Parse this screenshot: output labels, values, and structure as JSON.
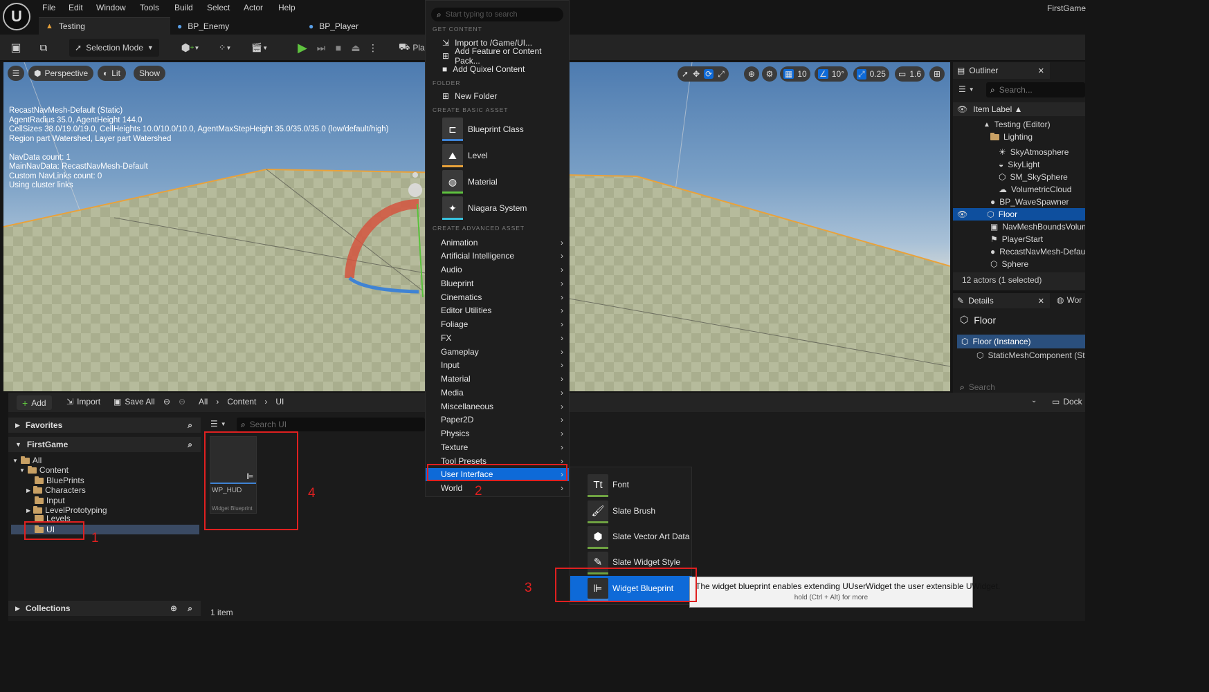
{
  "app": {
    "title": "FirstGame",
    "menu": [
      "File",
      "Edit",
      "Window",
      "Tools",
      "Build",
      "Select",
      "Actor",
      "Help"
    ],
    "tabs": [
      {
        "label": "Testing"
      },
      {
        "label": "BP_Enemy"
      },
      {
        "label": "BP_Player"
      }
    ]
  },
  "toolbar": {
    "selection_mode": "Selection Mode",
    "play_label": "Pla"
  },
  "viewport": {
    "perspective": "Perspective",
    "lit": "Lit",
    "show": "Show",
    "grid_snap": "10",
    "rot_snap": "10°",
    "scale_snap": "0.25",
    "cam_speed": "1.6",
    "nav_info": "RecastNavMesh-Default (Static)\nAgentRadius 35.0, AgentHeight 144.0\nCellSizes 38.0/19.0/19.0, CellHeights 10.0/10.0/10.0, AgentMaxStepHeight 35.0/35.0/35.0 (low/default/high)\nRegion part Watershed, Layer part Watershed\n\nNavData count: 1\nMainNavData: RecastNavMesh-Default\nCustom NavLinks count: 0\nUsing cluster links"
  },
  "outliner": {
    "title": "Outliner",
    "search_placeholder": "Search...",
    "column": "Item Label ▲",
    "items": [
      "Testing (Editor)",
      "Lighting",
      "SkyAtmosphere",
      "SkyLight",
      "SM_SkySphere",
      "VolumetricCloud",
      "BP_WaveSpawner",
      "Floor",
      "NavMeshBoundsVolum",
      "PlayerStart",
      "RecastNavMesh-Defau",
      "Sphere"
    ],
    "status": "12 actors (1 selected)"
  },
  "details": {
    "title": "Details",
    "world_tab": "Wor",
    "object": "Floor",
    "instance": "Floor (Instance)",
    "component": "StaticMeshComponent (St",
    "search_placeholder": "Search"
  },
  "content_browser": {
    "add": "Add",
    "import": "Import",
    "save_all": "Save All",
    "path": [
      "All",
      "Content",
      "UI"
    ],
    "dock": "Dock",
    "search_placeholder": "Search UI",
    "favorites": "Favorites",
    "project": "FirstGame",
    "collections": "Collections",
    "tree": [
      "All",
      "Content",
      "BluePrints",
      "Characters",
      "Input",
      "LevelPrototyping",
      "Levels",
      "UI"
    ],
    "asset": {
      "name": "WP_HUD",
      "type": "Widget Blueprint"
    },
    "count": "1 item"
  },
  "context_menu": {
    "search_placeholder": "Start typing to search",
    "sections": {
      "get_content": "GET CONTENT",
      "folder": "FOLDER",
      "basic": "CREATE BASIC ASSET",
      "advanced": "CREATE ADVANCED ASSET"
    },
    "get_content": [
      "Import to /Game/UI...",
      "Add Feature or Content Pack...",
      "Add Quixel Content"
    ],
    "new_folder": "New Folder",
    "basic": [
      "Blueprint Class",
      "Level",
      "Material",
      "Niagara System"
    ],
    "advanced": [
      "Animation",
      "Artificial Intelligence",
      "Audio",
      "Blueprint",
      "Cinematics",
      "Editor Utilities",
      "Foliage",
      "FX",
      "Gameplay",
      "Input",
      "Material",
      "Media",
      "Miscellaneous",
      "Paper2D",
      "Physics",
      "Texture",
      "Tool Presets",
      "User Interface",
      "World"
    ]
  },
  "submenu": {
    "items": [
      "Font",
      "Slate Brush",
      "Slate Vector Art Data",
      "Slate Widget Style",
      "Widget Blueprint"
    ]
  },
  "tooltip": {
    "text": "The widget blueprint enables extending UUserWidget the user extensible UWidget.",
    "hint": "hold (Ctrl + Alt) for more"
  },
  "annotations": [
    "1",
    "2",
    "3",
    "4"
  ],
  "colors": {
    "accent": "#0e6ad8",
    "annotation": "#e02020",
    "play": "#5fc33f"
  }
}
